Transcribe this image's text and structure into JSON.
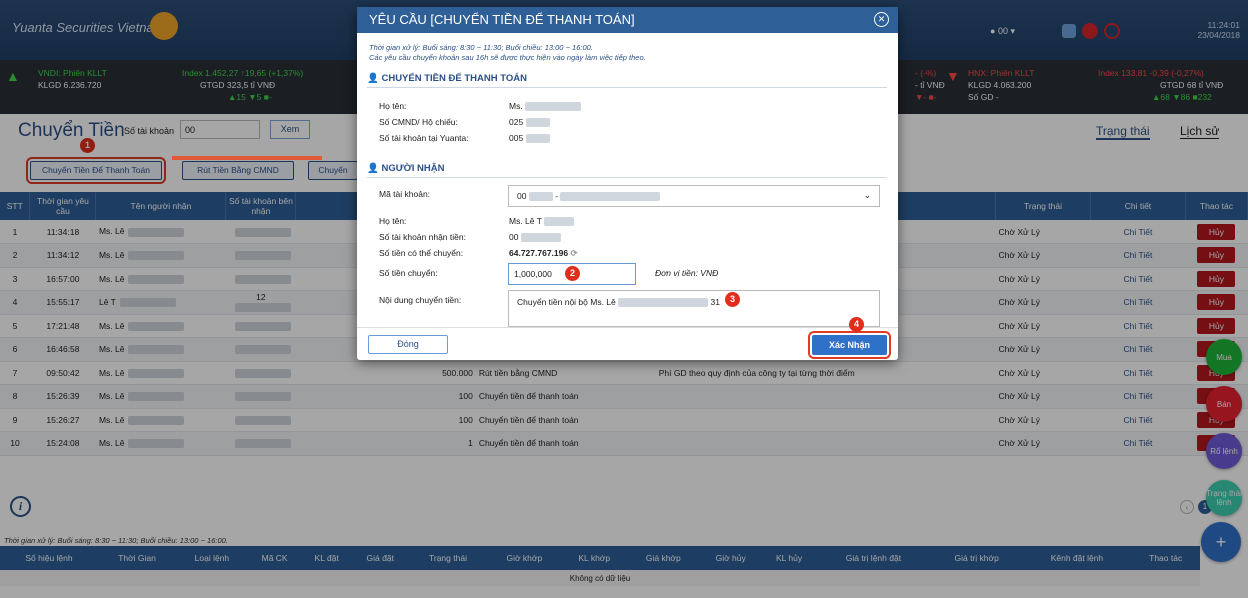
{
  "header": {
    "brand": "Yuanta Securities Vietnam",
    "account": "00",
    "time": "11:24:01",
    "date": "23/04/2018"
  },
  "ticker": {
    "left_status": "VNDI: Phiên KLLT",
    "left_vol": "KLGD 6.236.720",
    "left_index": "Index 1.452,27 ↑19,65 (+1,37%)",
    "left_gtgd": "GTGD 323,5 tỉ VNĐ",
    "left_adv": "▲15 ▼5 ■-",
    "mid_index": "- (-%)",
    "mid_gtgd": "- tỉ VNĐ",
    "mid_adv": "▼- ■-",
    "hnx_status": "HNX: Phiên KLLT",
    "hnx_vol": "KLGD 4.063.200",
    "hnx_sogd": "Số GD -",
    "right_index": "Index 133,81 -0,39 (-0,27%)",
    "right_gtgd": "GTGD 68 tỉ VNĐ",
    "right_adv": "▲68 ▼86 ■232"
  },
  "main": {
    "title": "Chuyển Tiền",
    "account_label": "Số tài khoản",
    "account_value": "00",
    "xem": "Xem",
    "tab_status": "Trạng thái",
    "tab_history": "Lịch sử",
    "btn_transfer": "Chuyển Tiền Để Thanh Toán",
    "btn_withdraw": "Rút Tiền Bằng CMND",
    "btn_other": "Chuyển"
  },
  "table": {
    "headers": [
      "STT",
      "Thời gian yêu cầu",
      "Tên người nhận",
      "Số tài khoản bên nhận",
      "",
      "",
      "",
      "Trạng thái",
      "Chi tiết",
      "Thao tác"
    ],
    "rows": [
      {
        "stt": "1",
        "time": "11:34:18",
        "name": "Ms. Lê",
        "acct": "",
        "amount": "",
        "type": "",
        "note": "",
        "status": "Chờ Xử Lý",
        "detail": "Chi Tiết",
        "action": "Hủy"
      },
      {
        "stt": "2",
        "time": "11:34:12",
        "name": "Ms. Lê",
        "acct": "",
        "amount": "",
        "type": "",
        "note": "",
        "status": "Chờ Xử Lý",
        "detail": "Chi Tiết",
        "action": "Hủy"
      },
      {
        "stt": "3",
        "time": "16:57:00",
        "name": "Ms. Lê",
        "acct": "",
        "amount": "",
        "type": "",
        "note": "",
        "status": "Chờ Xử Lý",
        "detail": "Chi Tiết",
        "action": "Hủy"
      },
      {
        "stt": "4",
        "time": "15:55:17",
        "name": "Lê T",
        "acct": "12",
        "amount": "",
        "type": "",
        "note": "",
        "status": "Chờ Xử Lý",
        "detail": "Chi Tiết",
        "action": "Hủy"
      },
      {
        "stt": "5",
        "time": "17:21:48",
        "name": "Ms. Lê",
        "acct": "",
        "amount": "",
        "type": "",
        "note": "",
        "status": "Chờ Xử Lý",
        "detail": "Chi Tiết",
        "action": "Hủy"
      },
      {
        "stt": "6",
        "time": "16:46:58",
        "name": "Ms. Lê",
        "acct": "",
        "amount": "500.000",
        "type": "Rút tiền bằng CMND",
        "note": "Phí GD theo quy định của công ty tại từng thời điểm",
        "status": "Chờ Xử Lý",
        "detail": "Chi Tiết",
        "action": "Hủy"
      },
      {
        "stt": "7",
        "time": "09:50:42",
        "name": "Ms. Lê",
        "acct": "",
        "amount": "500.000",
        "type": "Rút tiền bằng CMND",
        "note": "Phí GD theo quy định của công ty tại từng thời điểm",
        "status": "Chờ Xử Lý",
        "detail": "Chi Tiết",
        "action": "Hủy"
      },
      {
        "stt": "8",
        "time": "15:26:39",
        "name": "Ms. Lê",
        "acct": "",
        "amount": "100",
        "type": "Chuyển tiền để thanh toán",
        "note": "",
        "status": "Chờ Xử Lý",
        "detail": "Chi Tiết",
        "action": "Hủy"
      },
      {
        "stt": "9",
        "time": "15:26:27",
        "name": "Ms. Lê",
        "acct": "",
        "amount": "100",
        "type": "Chuyển tiền để thanh toán",
        "note": "",
        "status": "Chờ Xử Lý",
        "detail": "Chi Tiết",
        "action": "Hủy"
      },
      {
        "stt": "10",
        "time": "15:24:08",
        "name": "Ms. Lê",
        "acct": "",
        "amount": "1",
        "type": "Chuyển tiền để thanh toán",
        "note": "",
        "status": "Chờ Xử Lý",
        "detail": "Chi Tiết",
        "action": "Hủy"
      }
    ]
  },
  "pager": {
    "current": "1"
  },
  "orders": {
    "note": "Thời gian xử lý: Buổi sáng: 8:30 ~ 11:30; Buổi chiều: 13:00 ~ 16:00.",
    "headers": [
      "Số hiệu lệnh",
      "Thời Gian",
      "Loại lệnh",
      "Mã CK",
      "KL đặt",
      "Giá đặt",
      "Trạng thái",
      "Giờ khớp",
      "KL khớp",
      "Giá khớp",
      "Giờ hủy",
      "KL hủy",
      "Giá trị lệnh đặt",
      "Giá trị khớp",
      "Kênh đặt lệnh",
      "Thao tác"
    ],
    "empty": "Không có dữ liệu"
  },
  "fab": {
    "buy": "Mua",
    "sell": "Bán",
    "basket": "Rổ lệnh",
    "status": "Trạng thái lệnh",
    "add": "+"
  },
  "modal": {
    "title": "YÊU CẦU [CHUYỂN TIỀN ĐỂ THANH TOÁN]",
    "note1": "Thời gian xử lý: Buổi sáng: 8:30 ~ 11:30; Buổi chiều: 13:00 ~ 16:00.",
    "note2": "Các yêu cầu chuyển khoản sau 16h sẽ được thực hiện vào ngày làm việc tiếp theo.",
    "section1": "CHUYỂN TIỀN ĐỂ THANH TOÁN",
    "name_label": "Họ tên:",
    "name_value": "Ms.",
    "id_label": "Số CMND/ Hộ chiếu:",
    "id_value": "025",
    "acct_label": "Số tài khoản tại Yuanta:",
    "acct_value": "005",
    "section2": "NGƯỜI NHẬN",
    "recv_acct_label": "Mã tài khoản:",
    "recv_acct_value": "00",
    "recv_name_label": "Họ tên:",
    "recv_name_value": "Ms. Lê T",
    "recv_no_label": "Số tài khoản nhận tiền:",
    "recv_no_value": "00",
    "avail_label": "Số tiền có thể chuyển:",
    "avail_value": "64.727.767.196",
    "amount_label": "Số tiền chuyển:",
    "amount_value": "1,000,000",
    "unit": "Đơn vị tiền: VNĐ",
    "content_label": "Nội dung chuyển tiền:",
    "content_value": "Chuyển tiền nội bộ Ms. Lê",
    "content_suffix": "31",
    "close_btn": "Đóng",
    "confirm_btn": "Xác Nhận"
  },
  "markers": [
    "1",
    "2",
    "3",
    "4"
  ],
  "colors": {
    "primary": "#2f5f97",
    "danger": "#b5171f",
    "marker": "#e02d1c",
    "buy": "#1db53a",
    "sell": "#e8212e",
    "basket": "#6f59d9",
    "status": "#3ecfb0"
  }
}
